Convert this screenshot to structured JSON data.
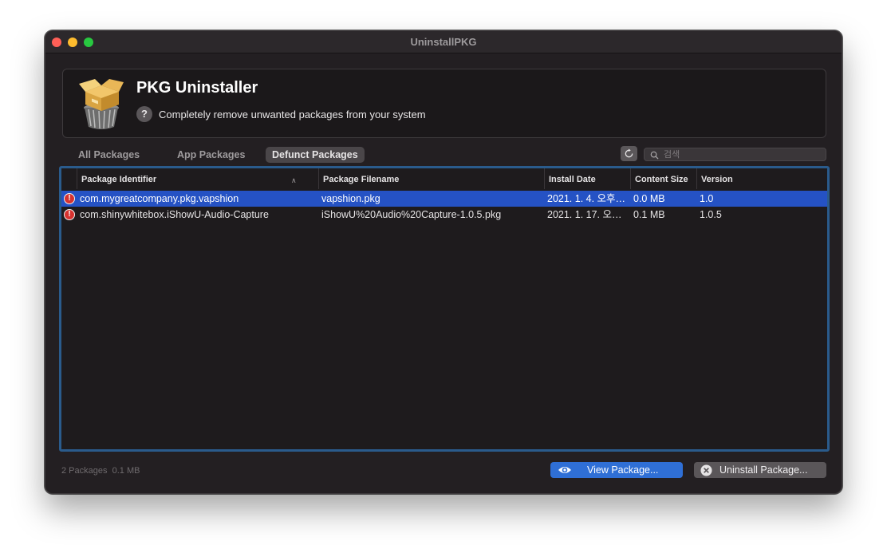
{
  "window": {
    "title": "UninstallPKG"
  },
  "header": {
    "title": "PKG Uninstaller",
    "help_glyph": "?",
    "subtitle": "Completely remove unwanted packages from your system",
    "icon": "package-trash-icon"
  },
  "tabs": [
    {
      "label": "All Packages",
      "selected": false
    },
    {
      "label": "App Packages",
      "selected": false
    },
    {
      "label": "Defunct Packages",
      "selected": true
    }
  ],
  "search": {
    "placeholder": "검색",
    "value": ""
  },
  "table": {
    "columns": [
      {
        "label": "Package Identifier",
        "sorted": "ascending"
      },
      {
        "label": "Package Filename"
      },
      {
        "label": "Install Date"
      },
      {
        "label": "Content Size"
      },
      {
        "label": "Version"
      }
    ],
    "rows": [
      {
        "status_icon": "warning-icon",
        "identifier": "com.mygreatcompany.pkg.vapshion",
        "filename": "vapshion.pkg",
        "install_date": "2021. 1. 4. 오후…",
        "size": "0.0 MB",
        "version": "1.0",
        "selected": true
      },
      {
        "status_icon": "warning-icon",
        "identifier": "com.shinywhitebox.iShowU-Audio-Capture",
        "filename": "iShowU%20Audio%20Capture-1.0.5.pkg",
        "install_date": "2021. 1. 17. 오…",
        "size": "0.1 MB",
        "version": "1.0.5",
        "selected": false
      }
    ]
  },
  "status": {
    "text": "2 Packages  0.1 MB"
  },
  "buttons": {
    "view_label": "View Package...",
    "uninstall_label": "Uninstall Package..."
  },
  "colors": {
    "window_bg": "#231f22",
    "selection": "#2552c4",
    "table_focus_ring": "#2a5b8c",
    "primary_button": "#2f6fd6",
    "warning": "#d6322f"
  }
}
